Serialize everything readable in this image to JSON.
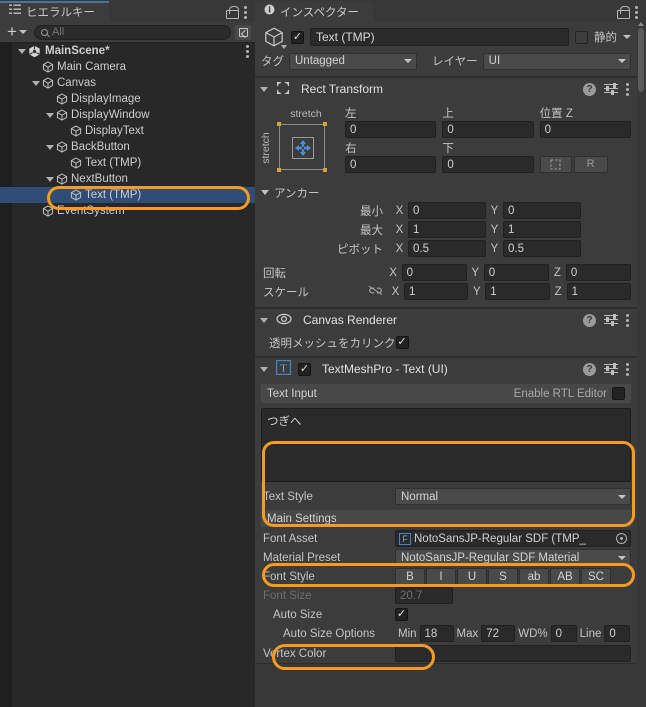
{
  "hierarchy": {
    "tab_label": "ヒエラルキー",
    "tab_icon": "hierarchy-icon",
    "lock_icon": "lock-icon",
    "menu_icon": "kebab-menu-icon",
    "toolbar": {
      "add_label": "+",
      "add_dropdown_icon": "chevron-down-icon",
      "search_icon": "search-icon",
      "search_placeholder": "All",
      "search_value": "",
      "window_icon": "open-in-window-icon"
    },
    "items": [
      {
        "label": "MainScene*",
        "depth": 0,
        "expanded": true,
        "icon": "unity-scene-icon",
        "selected": false,
        "has_menu": true
      },
      {
        "label": "Main Camera",
        "depth": 1,
        "expanded": null,
        "icon": "gameobject-cube-icon",
        "selected": false,
        "has_menu": false
      },
      {
        "label": "Canvas",
        "depth": 1,
        "expanded": true,
        "icon": "gameobject-cube-icon",
        "selected": false,
        "has_menu": false
      },
      {
        "label": "DisplayImage",
        "depth": 2,
        "expanded": null,
        "icon": "gameobject-cube-icon",
        "selected": false,
        "has_menu": false
      },
      {
        "label": "DisplayWindow",
        "depth": 2,
        "expanded": true,
        "icon": "gameobject-cube-icon",
        "selected": false,
        "has_menu": false
      },
      {
        "label": "DisplayText",
        "depth": 3,
        "expanded": null,
        "icon": "gameobject-cube-icon",
        "selected": false,
        "has_menu": false
      },
      {
        "label": "BackButton",
        "depth": 2,
        "expanded": true,
        "icon": "gameobject-cube-icon",
        "selected": false,
        "has_menu": false
      },
      {
        "label": "Text (TMP)",
        "depth": 3,
        "expanded": null,
        "icon": "gameobject-cube-icon",
        "selected": false,
        "has_menu": false
      },
      {
        "label": "NextButton",
        "depth": 2,
        "expanded": true,
        "icon": "gameobject-cube-icon",
        "selected": false,
        "has_menu": false
      },
      {
        "label": "Text (TMP)",
        "depth": 3,
        "expanded": null,
        "icon": "gameobject-cube-icon",
        "selected": true,
        "has_menu": false
      },
      {
        "label": "EventSystem",
        "depth": 1,
        "expanded": null,
        "icon": "gameobject-cube-icon",
        "selected": false,
        "has_menu": false
      }
    ]
  },
  "inspector": {
    "tab_label": "インスペクター",
    "tab_icon": "info-icon",
    "lock_icon": "lock-icon",
    "menu_icon": "kebab-menu-icon",
    "object_header": {
      "gameobject_icon": "gameobject-cube-icon",
      "enabled": true,
      "name": "Text (TMP)",
      "static_label": "静的",
      "static_checked": false,
      "static_dropdown_icon": "chevron-down-icon",
      "tag_label": "タグ",
      "tag_value": "Untagged",
      "layer_label": "レイヤー",
      "layer_value": "UI"
    },
    "rect_transform": {
      "title": "Rect Transform",
      "icon": "rect-transform-icon",
      "expanded": true,
      "help_icon": "help-icon",
      "preset_icon": "preset-icon",
      "menu_icon": "kebab-menu-icon",
      "anchor_preset_top_label": "stretch",
      "anchor_preset_left_label": "stretch",
      "left_label": "左",
      "left_value": "0",
      "top_label": "上",
      "top_value": "0",
      "posz_label": "位置 Z",
      "posz_value": "0",
      "right_label": "右",
      "right_value": "0",
      "bottom_label": "下",
      "bottom_value": "0",
      "blueprint_button_icon": "blueprint-mode-icon",
      "raw_button_label": "R",
      "anchors_label": "アンカー",
      "anchors_expanded": true,
      "min_label": "最小",
      "min_x": "0",
      "min_y": "0",
      "max_label": "最大",
      "max_x": "1",
      "max_y": "1",
      "pivot_label": "ピボット",
      "pivot_x": "0.5",
      "pivot_y": "0.5",
      "rotation_label": "回転",
      "rot_x": "0",
      "rot_y": "0",
      "rot_z": "0",
      "scale_label": "スケール",
      "scale_lock_icon": "broken-link-icon",
      "scale_x": "1",
      "scale_y": "1",
      "scale_z": "1",
      "axis_x": "X",
      "axis_y": "Y",
      "axis_z": "Z"
    },
    "canvas_renderer": {
      "title": "Canvas Renderer",
      "icon": "eye-icon",
      "expanded": true,
      "cull_label": "透明メッシュをカリンク",
      "cull_checked": true
    },
    "tmp": {
      "title": "TextMeshPro - Text (UI)",
      "icon": "tmp-T-icon",
      "enabled": true,
      "expanded": true,
      "text_input_label": "Text Input",
      "rtl_label": "Enable RTL Editor",
      "rtl_checked": false,
      "text_value": "つぎへ",
      "text_style_label": "Text Style",
      "text_style_value": "Normal",
      "main_settings_label": "Main Settings",
      "font_asset_label": "Font Asset",
      "font_asset_value": "NotoSansJP-Regular SDF (TMP_",
      "font_asset_icon": "font-asset-icon",
      "font_asset_picker_icon": "object-picker-icon",
      "material_preset_label": "Material Preset",
      "material_preset_value": "NotoSansJP-Regular SDF Material",
      "font_style_label": "Font Style",
      "font_style_buttons": [
        "B",
        "I",
        "U",
        "S",
        "ab",
        "AB",
        "SC"
      ],
      "font_size_label": "Font Size",
      "font_size_value": "20.7",
      "font_size_disabled": true,
      "auto_size_label": "Auto Size",
      "auto_size_checked": true,
      "auto_size_options_label": "Auto Size Options",
      "min_label": "Min",
      "min_value": "18",
      "max_label": "Max",
      "max_value": "72",
      "wd_label": "WD%",
      "wd_value": "0",
      "line_label": "Line",
      "line_value": "0",
      "vertex_color_label": "Vertex Color"
    }
  },
  "annotations": {
    "highlight_color": "#F59B23",
    "rings": [
      {
        "name": "hierarchy-selected-item-ring"
      },
      {
        "name": "text-input-ring"
      },
      {
        "name": "font-asset-ring"
      },
      {
        "name": "auto-size-ring"
      }
    ]
  },
  "colors": {
    "accent_orange": "#F59B23",
    "selection_blue": "#2f4d77",
    "panel_bg": "#383838",
    "component_bg": "#3c3c3c",
    "hierarchy_bg": "#282828"
  }
}
